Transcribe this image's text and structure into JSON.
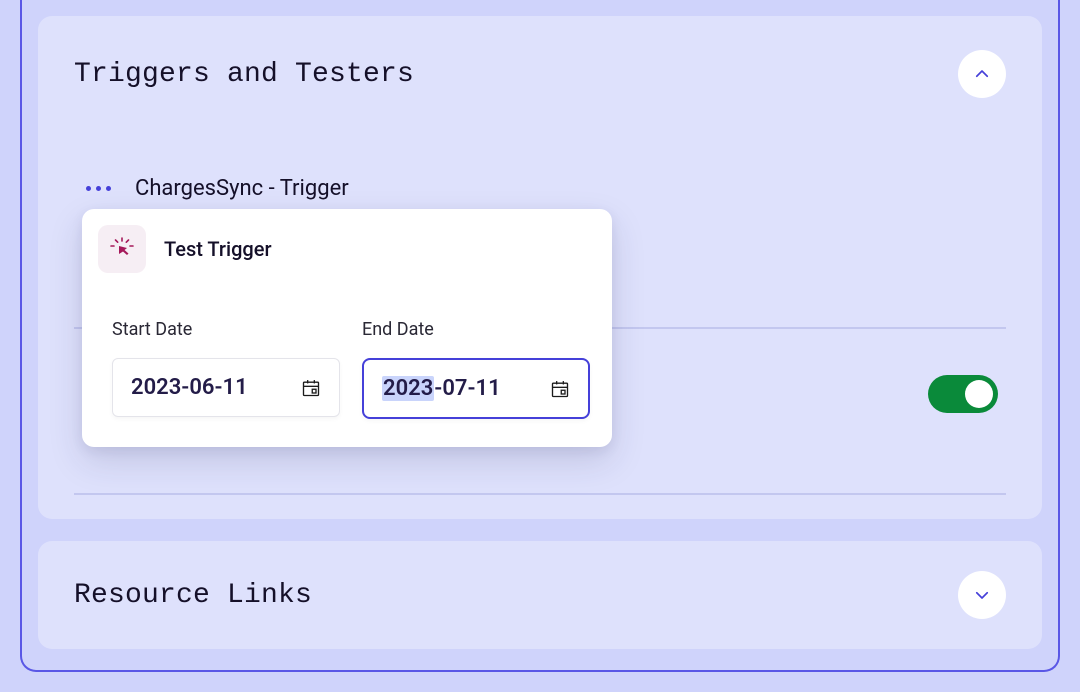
{
  "section1": {
    "title": "Triggers and Testers",
    "trigger_name": "ChargesSync - Trigger",
    "toggle_on": true
  },
  "section2": {
    "title": "Resource Links"
  },
  "popup": {
    "title": "Test Trigger",
    "start_label": "Start Date",
    "end_label": "End Date",
    "start_value": "2023-06-11",
    "end_year": "2023",
    "end_rest": "-07-11"
  }
}
